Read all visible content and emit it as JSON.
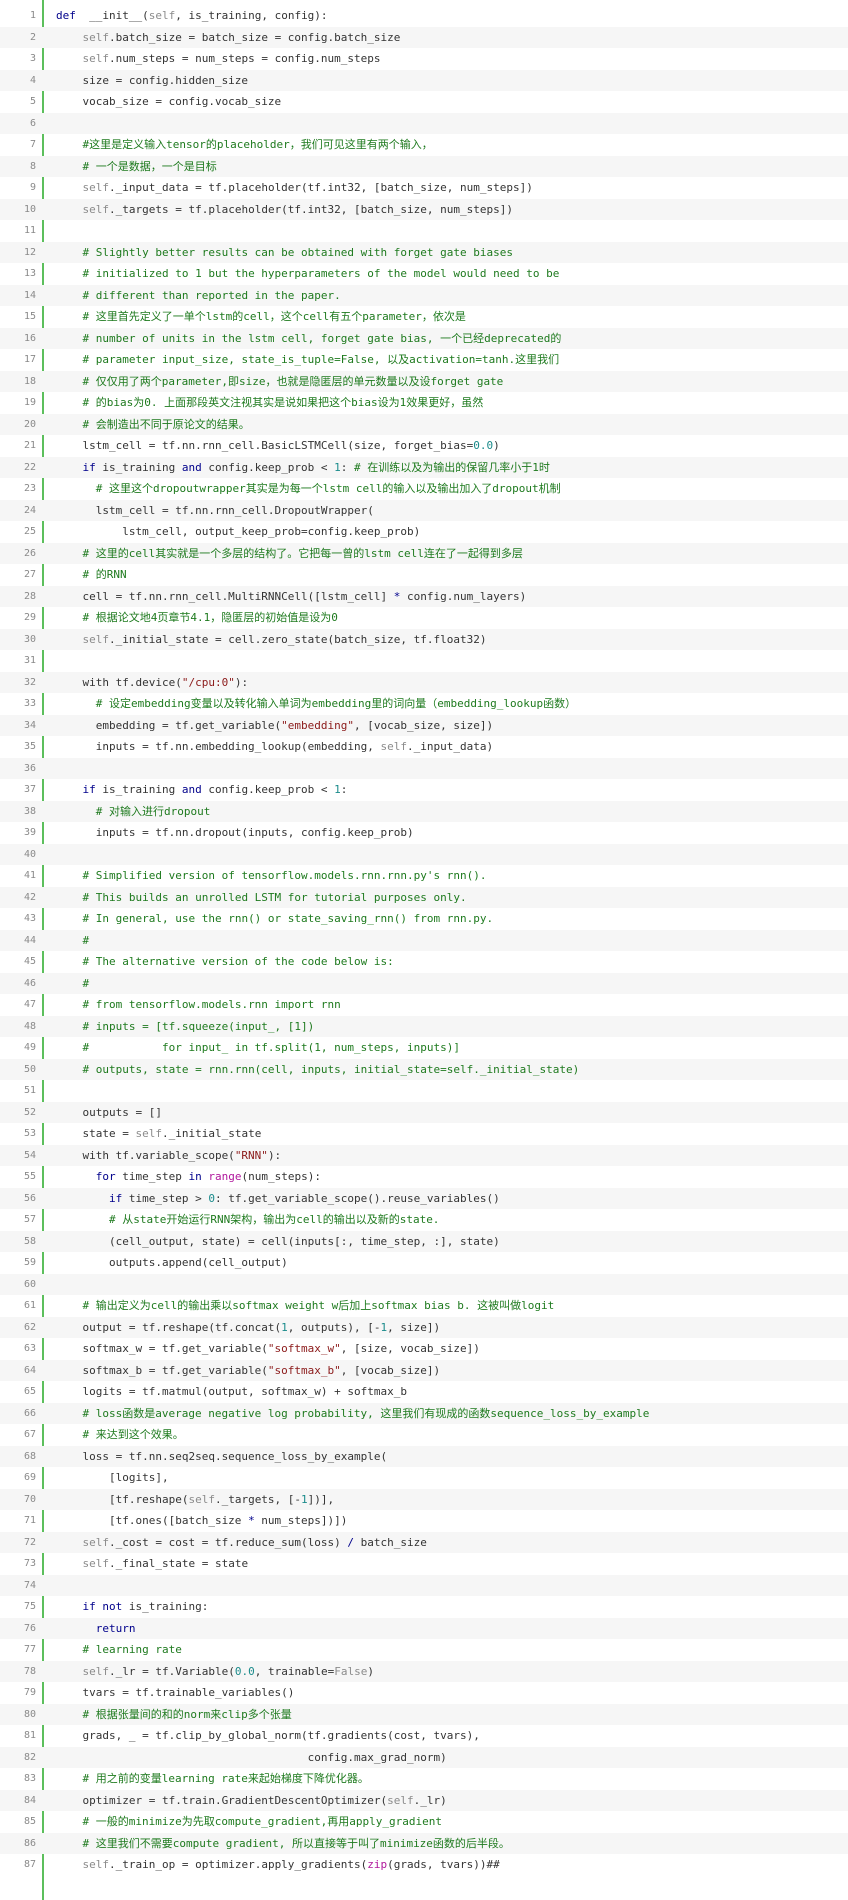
{
  "colors": {
    "keyword": "#00008b",
    "comment": "#1e7a1e",
    "self": "#8b8b8b",
    "string": "#8b1a1a",
    "number": "#1a8b8b",
    "builtin": "#b0179c",
    "plain": "#333333",
    "line_number": "#8a8a8a",
    "gutter_rule": "#5cbf5c",
    "stripe": "#f6f6f6"
  },
  "lines": [
    {
      "n": "1",
      "tokens": [
        [
          "kw",
          "def"
        ],
        [
          "",
          "  __init__("
        ],
        [
          "self",
          "self"
        ],
        [
          "",
          ", is_training, config):"
        ]
      ]
    },
    {
      "n": "2",
      "tokens": [
        [
          "",
          "    "
        ],
        [
          "self",
          "self"
        ],
        [
          "",
          ".batch_size = batch_size = config.batch_size"
        ]
      ]
    },
    {
      "n": "3",
      "tokens": [
        [
          "",
          "    "
        ],
        [
          "self",
          "self"
        ],
        [
          "",
          ".num_steps = num_steps = config.num_steps"
        ]
      ]
    },
    {
      "n": "4",
      "tokens": [
        [
          "",
          "    size = config.hidden_size"
        ]
      ]
    },
    {
      "n": "5",
      "tokens": [
        [
          "",
          "    vocab_size = config.vocab_size"
        ]
      ]
    },
    {
      "n": "6",
      "tokens": []
    },
    {
      "n": "7",
      "tokens": [
        [
          "",
          "    "
        ],
        [
          "com",
          "#这里是定义输入tensor的placeholder，我们可见这里有两个输入，"
        ]
      ]
    },
    {
      "n": "8",
      "tokens": [
        [
          "",
          "    "
        ],
        [
          "com",
          "# 一个是数据，一个是目标"
        ]
      ]
    },
    {
      "n": "9",
      "tokens": [
        [
          "",
          "    "
        ],
        [
          "self",
          "self"
        ],
        [
          "",
          "._input_data = tf.placeholder(tf.int32, [batch_size, num_steps])"
        ]
      ]
    },
    {
      "n": "10",
      "tokens": [
        [
          "",
          "    "
        ],
        [
          "self",
          "self"
        ],
        [
          "",
          "._targets = tf.placeholder(tf.int32, [batch_size, num_steps])"
        ]
      ]
    },
    {
      "n": "11",
      "tokens": []
    },
    {
      "n": "12",
      "tokens": [
        [
          "",
          "    "
        ],
        [
          "com",
          "# Slightly better results can be obtained with forget gate biases"
        ]
      ]
    },
    {
      "n": "13",
      "tokens": [
        [
          "",
          "    "
        ],
        [
          "com",
          "# initialized to 1 but the hyperparameters of the model would need to be"
        ]
      ]
    },
    {
      "n": "14",
      "tokens": [
        [
          "",
          "    "
        ],
        [
          "com",
          "# different than reported in the paper."
        ]
      ]
    },
    {
      "n": "15",
      "tokens": [
        [
          "",
          "    "
        ],
        [
          "com",
          "# 这里首先定义了一单个lstm的cell，这个cell有五个parameter，依次是"
        ]
      ]
    },
    {
      "n": "16",
      "tokens": [
        [
          "",
          "    "
        ],
        [
          "com",
          "# number of units in the lstm cell, forget gate bias, 一个已经deprecated的"
        ]
      ]
    },
    {
      "n": "17",
      "tokens": [
        [
          "",
          "    "
        ],
        [
          "com",
          "# parameter input_size, state_is_tuple=False, 以及activation=tanh.这里我们"
        ]
      ]
    },
    {
      "n": "18",
      "tokens": [
        [
          "",
          "    "
        ],
        [
          "com",
          "# 仅仅用了两个parameter,即size，也就是隐匿层的单元数量以及设forget gate"
        ]
      ]
    },
    {
      "n": "19",
      "tokens": [
        [
          "",
          "    "
        ],
        [
          "com",
          "# 的bias为0. 上面那段英文注视其实是说如果把这个bias设为1效果更好，虽然"
        ]
      ]
    },
    {
      "n": "20",
      "tokens": [
        [
          "",
          "    "
        ],
        [
          "com",
          "# 会制造出不同于原论文的结果。"
        ]
      ]
    },
    {
      "n": "21",
      "tokens": [
        [
          "",
          "    lstm_cell = tf.nn.rnn_cell.BasicLSTMCell(size, forget_bias="
        ],
        [
          "num",
          "0.0"
        ],
        [
          "",
          ")"
        ]
      ]
    },
    {
      "n": "22",
      "tokens": [
        [
          "",
          "    "
        ],
        [
          "kw",
          "if"
        ],
        [
          "",
          " is_training "
        ],
        [
          "kw",
          "and"
        ],
        [
          "",
          " config.keep_prob < "
        ],
        [
          "num",
          "1"
        ],
        [
          ":",
          " "
        ],
        [
          "com",
          "# 在训练以及为输出的保留几率小于1时"
        ]
      ]
    },
    {
      "n": "23",
      "tokens": [
        [
          "",
          "      "
        ],
        [
          "com",
          "# 这里这个dropoutwrapper其实是为每一个lstm cell的输入以及输出加入了dropout机制"
        ]
      ]
    },
    {
      "n": "24",
      "tokens": [
        [
          "",
          "      lstm_cell = tf.nn.rnn_cell.DropoutWrapper("
        ]
      ]
    },
    {
      "n": "25",
      "tokens": [
        [
          "",
          "          lstm_cell, output_keep_prob=config.keep_prob)"
        ]
      ]
    },
    {
      "n": "26",
      "tokens": [
        [
          "",
          "    "
        ],
        [
          "com",
          "# 这里的cell其实就是一个多层的结构了。它把每一曾的lstm cell连在了一起得到多层"
        ]
      ]
    },
    {
      "n": "27",
      "tokens": [
        [
          "",
          "    "
        ],
        [
          "com",
          "# 的RNN"
        ]
      ]
    },
    {
      "n": "28",
      "tokens": [
        [
          "",
          "    cell = tf.nn.rnn_cell.MultiRNNCell([lstm_cell] "
        ],
        [
          "kw",
          "*"
        ],
        [
          "",
          " config.num_layers)"
        ]
      ]
    },
    {
      "n": "29",
      "tokens": [
        [
          "",
          "    "
        ],
        [
          "com",
          "# 根据论文地4页章节4.1，隐匿层的初始值是设为0"
        ]
      ]
    },
    {
      "n": "30",
      "tokens": [
        [
          "",
          "    "
        ],
        [
          "self",
          "self"
        ],
        [
          "",
          "._initial_state = cell.zero_state(batch_size, tf.float32)"
        ]
      ]
    },
    {
      "n": "31",
      "tokens": []
    },
    {
      "n": "32",
      "tokens": [
        [
          "",
          "    with tf.device("
        ],
        [
          "str",
          "\"/cpu:0\""
        ],
        [
          "",
          "):"
        ]
      ]
    },
    {
      "n": "33",
      "tokens": [
        [
          "",
          "      "
        ],
        [
          "com",
          "# 设定embedding变量以及转化输入单词为embedding里的词向量（embedding_lookup函数）"
        ]
      ]
    },
    {
      "n": "34",
      "tokens": [
        [
          "",
          "      embedding = tf.get_variable("
        ],
        [
          "str",
          "\"embedding\""
        ],
        [
          "",
          ", [vocab_size, size])"
        ]
      ]
    },
    {
      "n": "35",
      "tokens": [
        [
          "",
          "      inputs = tf.nn.embedding_lookup(embedding, "
        ],
        [
          "self",
          "self"
        ],
        [
          "",
          "._input_data)"
        ]
      ]
    },
    {
      "n": "36",
      "tokens": []
    },
    {
      "n": "37",
      "tokens": [
        [
          "",
          "    "
        ],
        [
          "kw",
          "if"
        ],
        [
          "",
          " is_training "
        ],
        [
          "kw",
          "and"
        ],
        [
          "",
          " config.keep_prob < "
        ],
        [
          "num",
          "1"
        ],
        [
          "",
          ":"
        ]
      ]
    },
    {
      "n": "38",
      "tokens": [
        [
          "",
          "      "
        ],
        [
          "com",
          "# 对输入进行dropout"
        ]
      ]
    },
    {
      "n": "39",
      "tokens": [
        [
          "",
          "      inputs = tf.nn.dropout(inputs, config.keep_prob)"
        ]
      ]
    },
    {
      "n": "40",
      "tokens": []
    },
    {
      "n": "41",
      "tokens": [
        [
          "",
          "    "
        ],
        [
          "com",
          "# Simplified version of tensorflow.models.rnn.rnn.py's rnn()."
        ]
      ]
    },
    {
      "n": "42",
      "tokens": [
        [
          "",
          "    "
        ],
        [
          "com",
          "# This builds an unrolled LSTM for tutorial purposes only."
        ]
      ]
    },
    {
      "n": "43",
      "tokens": [
        [
          "",
          "    "
        ],
        [
          "com",
          "# In general, use the rnn() or state_saving_rnn() from rnn.py."
        ]
      ]
    },
    {
      "n": "44",
      "tokens": [
        [
          "",
          "    "
        ],
        [
          "com",
          "#"
        ]
      ]
    },
    {
      "n": "45",
      "tokens": [
        [
          "",
          "    "
        ],
        [
          "com",
          "# The alternative version of the code below is:"
        ]
      ]
    },
    {
      "n": "46",
      "tokens": [
        [
          "",
          "    "
        ],
        [
          "com",
          "#"
        ]
      ]
    },
    {
      "n": "47",
      "tokens": [
        [
          "",
          "    "
        ],
        [
          "com",
          "# from tensorflow.models.rnn import rnn"
        ]
      ]
    },
    {
      "n": "48",
      "tokens": [
        [
          "",
          "    "
        ],
        [
          "com",
          "# inputs = [tf.squeeze(input_, [1])"
        ]
      ]
    },
    {
      "n": "49",
      "tokens": [
        [
          "",
          "    "
        ],
        [
          "com",
          "#           for input_ in tf.split(1, num_steps, inputs)]"
        ]
      ]
    },
    {
      "n": "50",
      "tokens": [
        [
          "",
          "    "
        ],
        [
          "com",
          "# outputs, state = rnn.rnn(cell, inputs, initial_state=self._initial_state)"
        ]
      ]
    },
    {
      "n": "51",
      "tokens": []
    },
    {
      "n": "52",
      "tokens": [
        [
          "",
          "    outputs = []"
        ]
      ]
    },
    {
      "n": "53",
      "tokens": [
        [
          "",
          "    state = "
        ],
        [
          "self",
          "self"
        ],
        [
          "",
          "._initial_state"
        ]
      ]
    },
    {
      "n": "54",
      "tokens": [
        [
          "",
          "    with tf.variable_scope("
        ],
        [
          "str",
          "\"RNN\""
        ],
        [
          "",
          "):"
        ]
      ]
    },
    {
      "n": "55",
      "tokens": [
        [
          "",
          "      "
        ],
        [
          "kw",
          "for"
        ],
        [
          "",
          " time_step "
        ],
        [
          "kw",
          "in"
        ],
        [
          " ",
          " "
        ],
        [
          "bi",
          "range"
        ],
        [
          "",
          "(num_steps):"
        ]
      ]
    },
    {
      "n": "56",
      "tokens": [
        [
          "",
          "        "
        ],
        [
          "kw",
          "if"
        ],
        [
          "",
          " time_step > "
        ],
        [
          "num",
          "0"
        ],
        [
          "",
          ": tf.get_variable_scope().reuse_variables()"
        ]
      ]
    },
    {
      "n": "57",
      "tokens": [
        [
          "",
          "        "
        ],
        [
          "com",
          "# 从state开始运行RNN架构，输出为cell的输出以及新的state."
        ]
      ]
    },
    {
      "n": "58",
      "tokens": [
        [
          "",
          "        (cell_output, state) = cell(inputs[:, time_step, :], state)"
        ]
      ]
    },
    {
      "n": "59",
      "tokens": [
        [
          "",
          "        outputs.append(cell_output)"
        ]
      ]
    },
    {
      "n": "60",
      "tokens": []
    },
    {
      "n": "61",
      "tokens": [
        [
          "",
          "    "
        ],
        [
          "com",
          "# 输出定义为cell的输出乘以softmax weight w后加上softmax bias b. 这被叫做logit"
        ]
      ]
    },
    {
      "n": "62",
      "tokens": [
        [
          "",
          "    output = tf.reshape(tf.concat("
        ],
        [
          "num",
          "1"
        ],
        [
          "",
          ", outputs), [-"
        ],
        [
          "num",
          "1"
        ],
        [
          "",
          ", size])"
        ]
      ]
    },
    {
      "n": "63",
      "tokens": [
        [
          "",
          "    softmax_w = tf.get_variable("
        ],
        [
          "str",
          "\"softmax_w\""
        ],
        [
          "",
          ", [size, vocab_size])"
        ]
      ]
    },
    {
      "n": "64",
      "tokens": [
        [
          "",
          "    softmax_b = tf.get_variable("
        ],
        [
          "str",
          "\"softmax_b\""
        ],
        [
          "",
          ", [vocab_size])"
        ]
      ]
    },
    {
      "n": "65",
      "tokens": [
        [
          "",
          "    logits = tf.matmul(output, softmax_w) + softmax_b"
        ]
      ]
    },
    {
      "n": "66",
      "tokens": [
        [
          "",
          "    "
        ],
        [
          "com",
          "# loss函数是average negative log probability, 这里我们有现成的函数sequence_loss_by_example"
        ]
      ]
    },
    {
      "n": "67",
      "tokens": [
        [
          "",
          "    "
        ],
        [
          "com",
          "# 来达到这个效果。"
        ]
      ]
    },
    {
      "n": "68",
      "tokens": [
        [
          "",
          "    loss = tf.nn.seq2seq.sequence_loss_by_example("
        ]
      ]
    },
    {
      "n": "69",
      "tokens": [
        [
          "",
          "        [logits],"
        ]
      ]
    },
    {
      "n": "70",
      "tokens": [
        [
          "",
          "        [tf.reshape("
        ],
        [
          "self",
          "self"
        ],
        [
          "",
          "._targets, [-"
        ],
        [
          "num",
          "1"
        ],
        [
          "",
          "])],"
        ]
      ]
    },
    {
      "n": "71",
      "tokens": [
        [
          "",
          "        [tf.ones([batch_size "
        ],
        [
          "kw",
          "*"
        ],
        [
          "",
          " num_steps])])"
        ]
      ]
    },
    {
      "n": "72",
      "tokens": [
        [
          "",
          "    "
        ],
        [
          "self",
          "self"
        ],
        [
          "",
          "._cost = cost = tf.reduce_sum(loss) "
        ],
        [
          "kw",
          "/"
        ],
        [
          "",
          " batch_size"
        ]
      ]
    },
    {
      "n": "73",
      "tokens": [
        [
          "",
          "    "
        ],
        [
          "self",
          "self"
        ],
        [
          "",
          "._final_state = state"
        ]
      ]
    },
    {
      "n": "74",
      "tokens": []
    },
    {
      "n": "75",
      "tokens": [
        [
          "",
          "    "
        ],
        [
          "kw",
          "if not"
        ],
        [
          "",
          " is_training:"
        ]
      ]
    },
    {
      "n": "76",
      "tokens": [
        [
          "",
          "      "
        ],
        [
          "kw",
          "return"
        ]
      ]
    },
    {
      "n": "77",
      "tokens": [
        [
          "",
          "    "
        ],
        [
          "com",
          "# learning rate"
        ]
      ]
    },
    {
      "n": "78",
      "tokens": [
        [
          "",
          "    "
        ],
        [
          "self",
          "self"
        ],
        [
          "",
          "._lr = tf.Variable("
        ],
        [
          "num",
          "0.0"
        ],
        [
          "",
          ", trainable="
        ],
        [
          "self",
          "False"
        ],
        [
          "",
          ")"
        ]
      ]
    },
    {
      "n": "79",
      "tokens": [
        [
          "",
          "    tvars = tf.trainable_variables()"
        ]
      ]
    },
    {
      "n": "80",
      "tokens": [
        [
          "",
          "    "
        ],
        [
          "com",
          "# 根据张量间的和的norm来clip多个张量"
        ]
      ]
    },
    {
      "n": "81",
      "tokens": [
        [
          "",
          "    grads, _ = tf.clip_by_global_norm(tf.gradients(cost, tvars),"
        ]
      ]
    },
    {
      "n": "82",
      "tokens": [
        [
          "",
          "                                      config.max_grad_norm)"
        ]
      ]
    },
    {
      "n": "83",
      "tokens": [
        [
          "",
          "    "
        ],
        [
          "com",
          "# 用之前的变量learning rate来起始梯度下降优化器。"
        ]
      ]
    },
    {
      "n": "84",
      "tokens": [
        [
          "",
          "    optimizer = tf.train.GradientDescentOptimizer("
        ],
        [
          "self",
          "self"
        ],
        [
          "",
          "._lr)"
        ]
      ]
    },
    {
      "n": "85",
      "tokens": [
        [
          "",
          "    "
        ],
        [
          "com",
          "# 一般的minimize为先取compute_gradient,再用apply_gradient"
        ]
      ]
    },
    {
      "n": "86",
      "tokens": [
        [
          "",
          "    "
        ],
        [
          "com",
          "# 这里我们不需要compute gradient, 所以直接等于叫了minimize函数的后半段。"
        ]
      ]
    },
    {
      "n": "87",
      "tokens": [
        [
          "",
          "    "
        ],
        [
          "self",
          "self"
        ],
        [
          "",
          "._train_op = optimizer.apply_gradients("
        ],
        [
          "bi",
          "zip"
        ],
        [
          "",
          "(grads, tvars))##"
        ]
      ]
    }
  ]
}
